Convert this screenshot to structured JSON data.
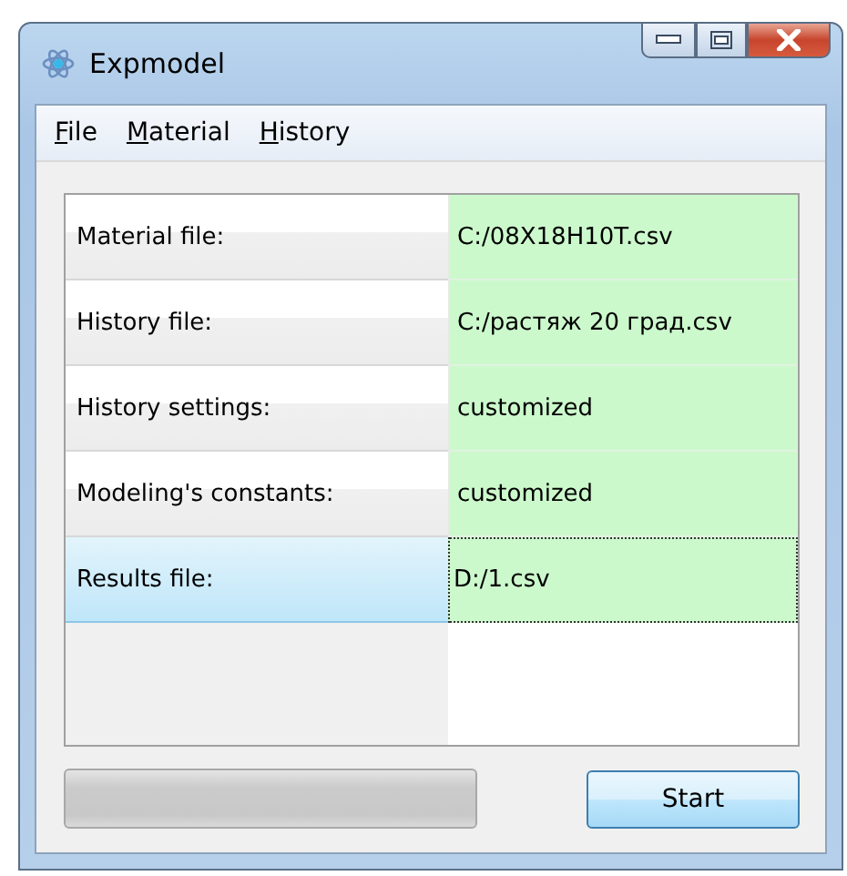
{
  "window": {
    "title": "Expmodel"
  },
  "menu": [
    "File",
    "Material",
    "History"
  ],
  "rows": [
    {
      "label": "Material file:",
      "value": "C:/08X18H10T.csv",
      "selected": false
    },
    {
      "label": "History file:",
      "value": "C:/растяж 20 град.csv",
      "selected": false
    },
    {
      "label": "History settings:",
      "value": "customized",
      "selected": false
    },
    {
      "label": "Modeling's constants:",
      "value": "customized",
      "selected": false
    },
    {
      "label": "Results file:",
      "value": "D:/1.csv",
      "selected": true
    }
  ],
  "progress": {
    "level": 0
  },
  "buttons": [
    "Start"
  ]
}
